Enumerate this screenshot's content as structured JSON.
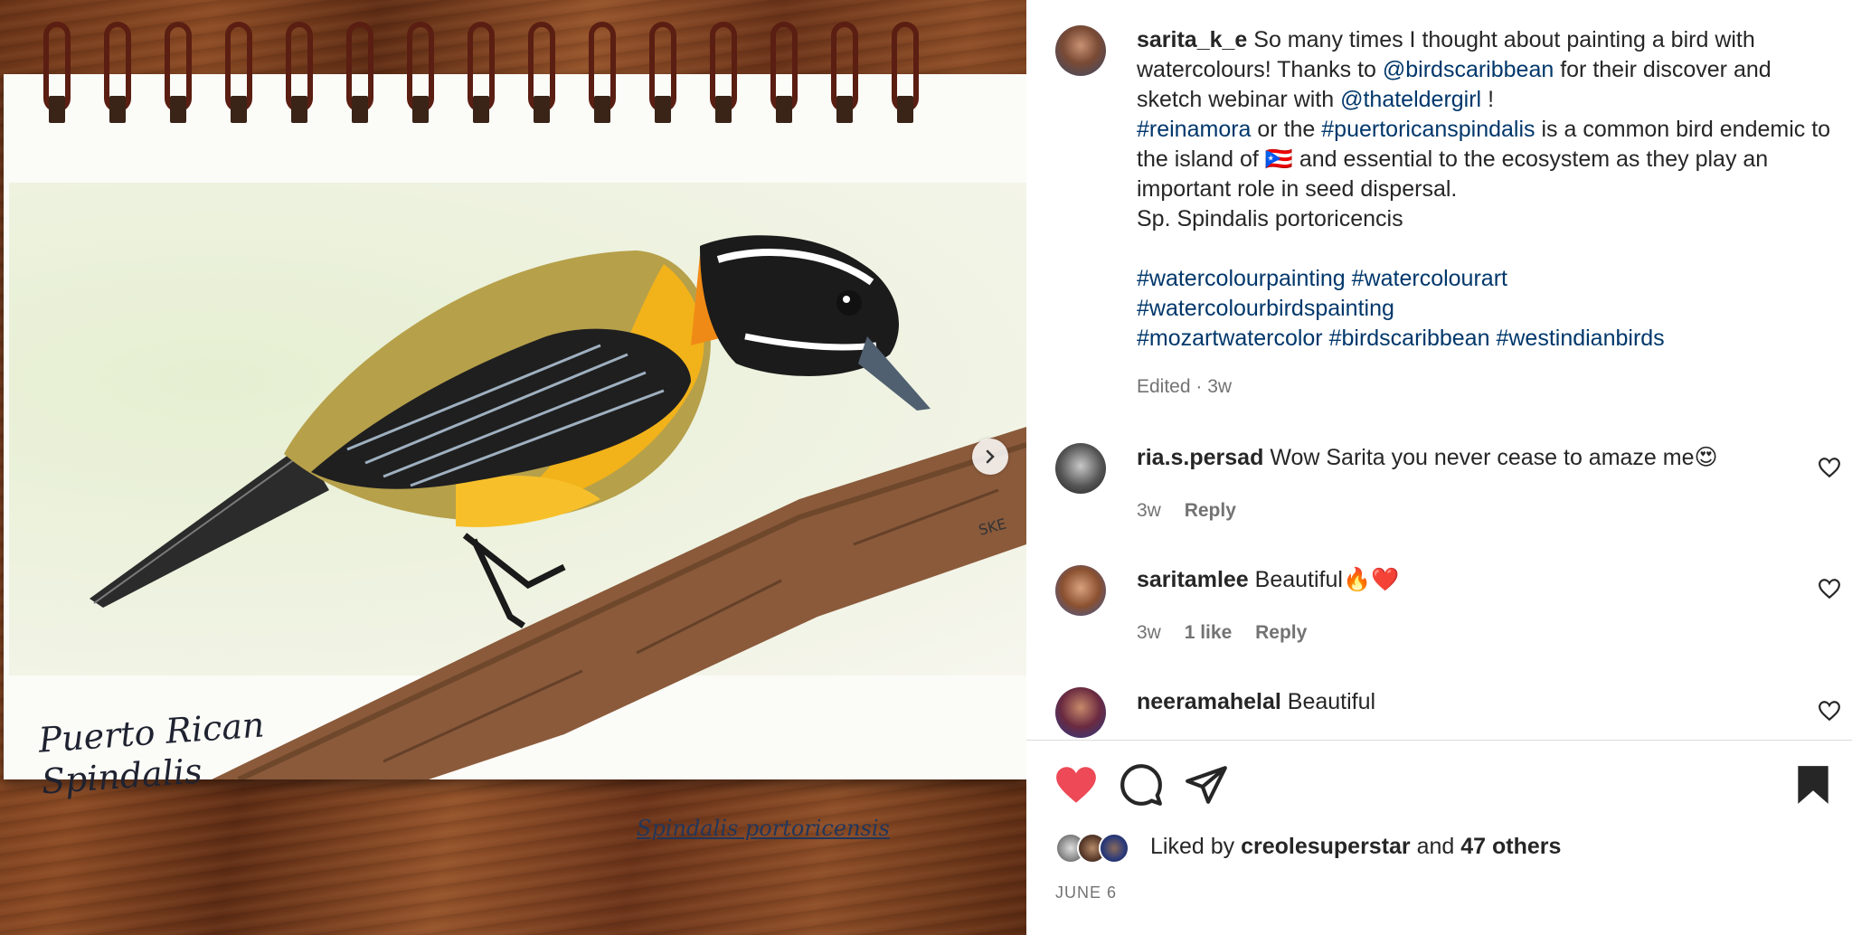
{
  "post": {
    "author": "sarita_k_e",
    "caption_lines": [
      [
        "So many times I thought about painting a bird with watercolours! Thanks to ",
        "@birdscaribbean",
        " for their discover and sketch webinar with ",
        "@thateldergirl",
        " !"
      ],
      [
        "#reinamora",
        " or the ",
        "#puertoricanspindalis",
        " is a common bird endemic to the island of 🇵🇷 and essential to the ecosystem as they play an important role in seed dispersal."
      ],
      [
        "Sp. Spindalis portoricencis"
      ],
      [
        ""
      ],
      [
        "#watercolourpainting",
        " ",
        "#watercolourart"
      ],
      [
        "#watercolourbirdspainting"
      ],
      [
        "#mozartwatercolor",
        " ",
        "#birdscaribbean",
        " ",
        "#westindianbirds"
      ]
    ],
    "edited_time": "Edited · 3w"
  },
  "artwork": {
    "handwritten_name": "Puerto Rican Spindalis",
    "handwritten_scientific": "Spindalis portoricensis"
  },
  "comments": [
    {
      "user": "ria.s.persad",
      "text": "Wow Sarita you never cease to amaze me😍",
      "time": "3w",
      "likes": "",
      "reply": "Reply"
    },
    {
      "user": "saritamlee",
      "text": "Beautiful🔥❤️",
      "time": "3w",
      "likes": "1 like",
      "reply": "Reply"
    },
    {
      "user": "neeramahelal",
      "text": "Beautiful",
      "time": "",
      "likes": "",
      "reply": ""
    }
  ],
  "likes": {
    "prefix": "Liked by ",
    "user": "creolesuperstar",
    "middle": " and ",
    "others": "47 others"
  },
  "date": "JUNE 6",
  "colors": {
    "like_red": "#ed4956",
    "link_blue": "#00376b",
    "meta_gray": "#737373"
  },
  "icons": [
    "chevron-right-icon",
    "heart-filled-icon",
    "comment-icon",
    "share-icon",
    "bookmark-filled-icon",
    "heart-outline-icon"
  ]
}
